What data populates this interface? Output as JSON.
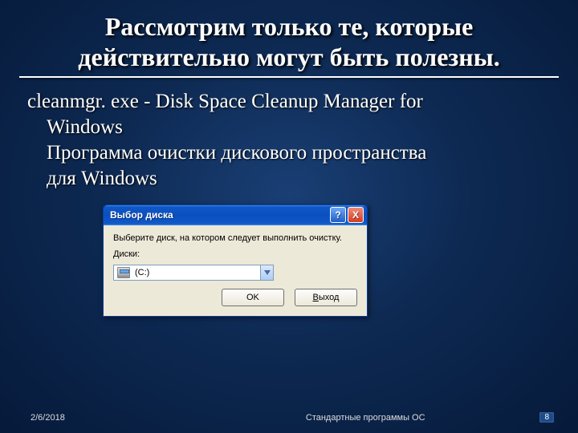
{
  "title_line1": "Рассмотрим только те, которые",
  "title_line2": "действительно могут быть полезны.",
  "body": {
    "line1": "cleanmgr. exe - Disk Space Cleanup Manager for",
    "line2": "Windows",
    "line3": "Программа очистки дискового пространства",
    "line4": "для Windows"
  },
  "dialog": {
    "title": "Выбор диска",
    "help": "?",
    "close": "X",
    "instruction": "Выберите диск, на котором следует выполнить очистку.",
    "drives_label": "Диски:",
    "selected_drive": "(C:)",
    "ok_label": "OK",
    "exit_label_u": "В",
    "exit_label_rest": "ыход"
  },
  "footer": {
    "date": "2/6/2018",
    "caption": "Стандартные программы ОС",
    "page": "8"
  }
}
